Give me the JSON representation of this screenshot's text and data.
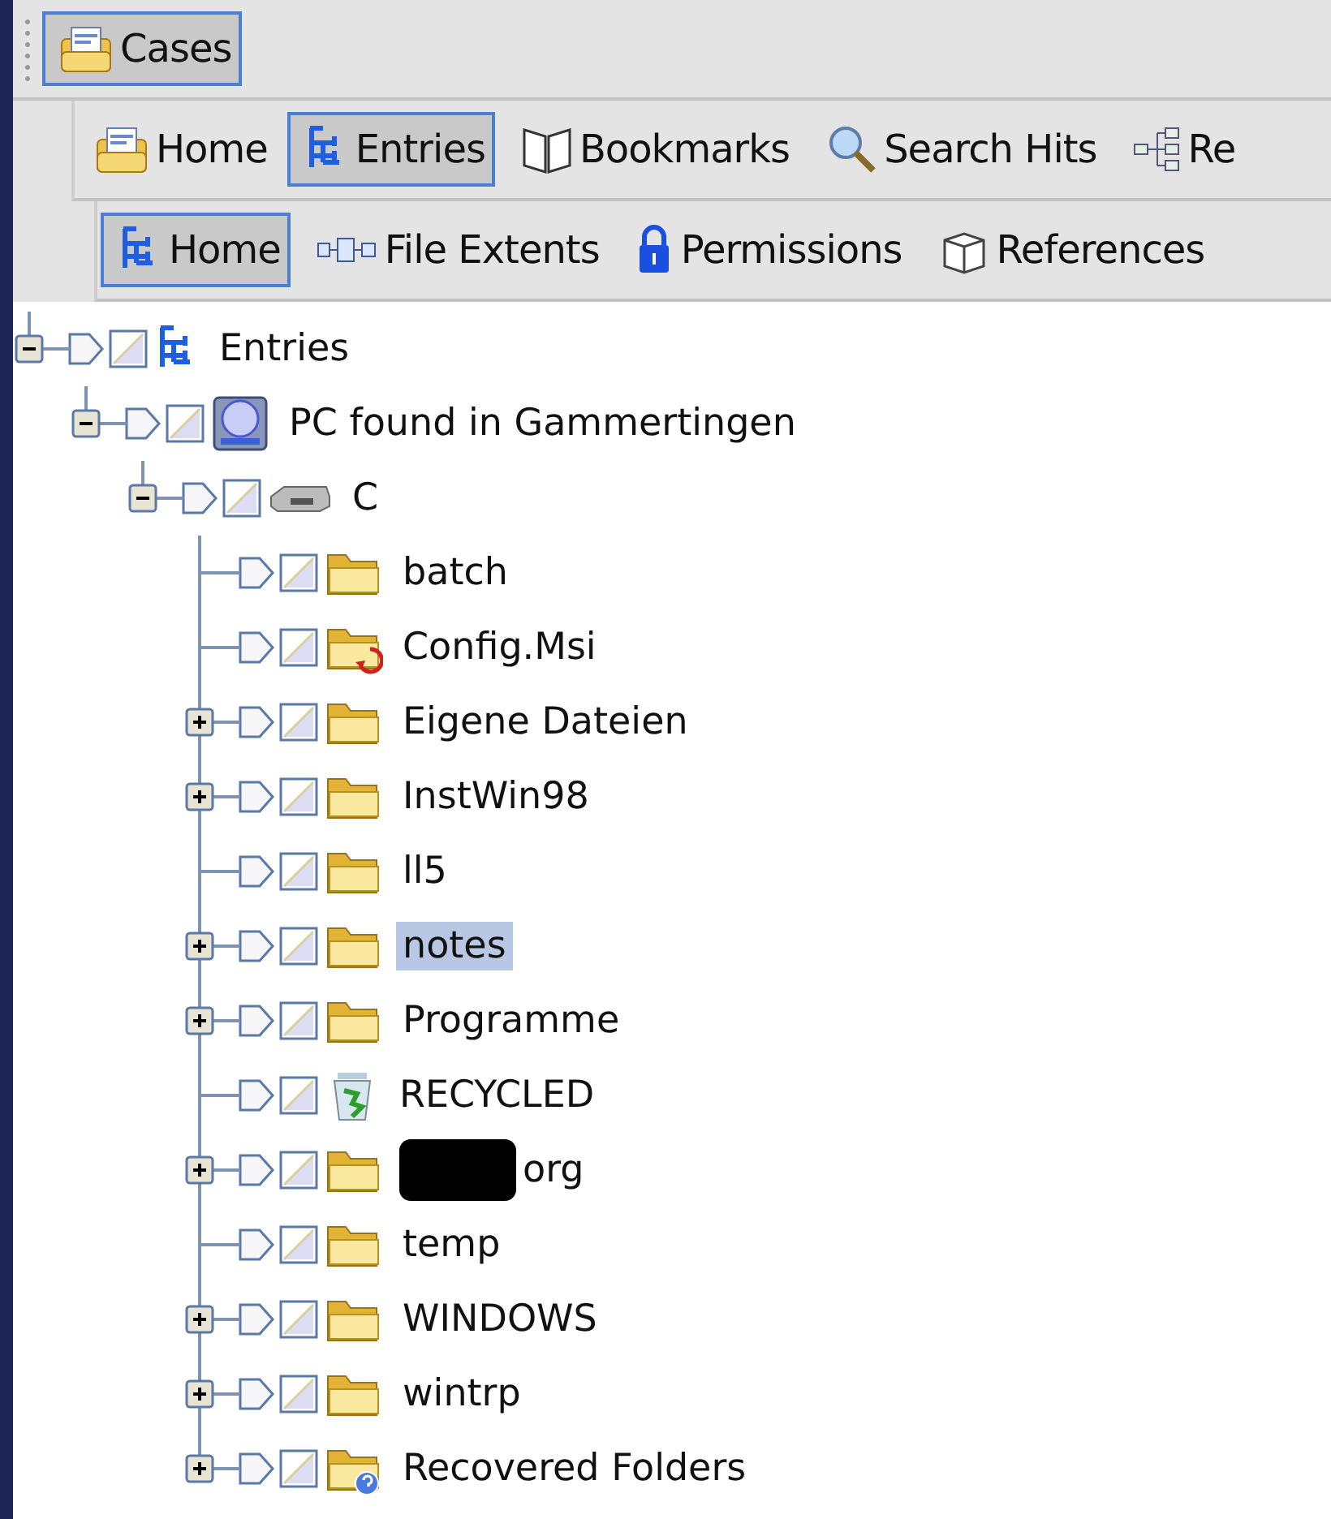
{
  "toolbars": [
    {
      "grip": true,
      "buttons": [
        {
          "label": "Cases",
          "kind": "case",
          "selected": true
        }
      ]
    },
    {
      "grip": false,
      "buttons": [
        {
          "label": "Home",
          "kind": "case",
          "selected": false
        },
        {
          "label": "Entries",
          "kind": "tree",
          "selected": true
        },
        {
          "label": "Bookmarks",
          "kind": "book",
          "selected": false
        },
        {
          "label": "Search Hits",
          "kind": "search",
          "selected": false
        },
        {
          "label": "Re",
          "kind": "nodes",
          "selected": false
        }
      ]
    },
    {
      "grip": false,
      "buttons": [
        {
          "label": "Home",
          "kind": "tree",
          "selected": true
        },
        {
          "label": "File Extents",
          "kind": "extents",
          "selected": false
        },
        {
          "label": "Permissions",
          "kind": "lock",
          "selected": false
        },
        {
          "label": "References",
          "kind": "box",
          "selected": false
        }
      ]
    }
  ],
  "tree": [
    {
      "label": "Entries",
      "kind": "tree",
      "expanded": true,
      "checked": false,
      "selected": false,
      "children": [
        {
          "label": "PC found in Gammertingen",
          "kind": "computer",
          "expanded": true,
          "checked": false,
          "selected": false,
          "children": [
            {
              "label": "C",
              "kind": "drive",
              "expanded": true,
              "checked": false,
              "selected": false,
              "children": [
                {
                  "label": "batch",
                  "kind": "folder",
                  "checked": false,
                  "selected": false
                },
                {
                  "label": "Config.Msi",
                  "kind": "folder-arrow",
                  "checked": false,
                  "selected": false
                },
                {
                  "label": "Eigene Dateien",
                  "kind": "folder",
                  "expanded": false,
                  "checked": false,
                  "selected": false
                },
                {
                  "label": "InstWin98",
                  "kind": "folder",
                  "expanded": false,
                  "checked": false,
                  "selected": false
                },
                {
                  "label": "ll5",
                  "kind": "folder",
                  "checked": false,
                  "selected": false
                },
                {
                  "label": "notes",
                  "kind": "folder",
                  "expanded": false,
                  "checked": false,
                  "selected": true
                },
                {
                  "label": "Programme",
                  "kind": "folder",
                  "expanded": false,
                  "checked": false,
                  "selected": false
                },
                {
                  "label": "RECYCLED",
                  "kind": "recycle",
                  "checked": false,
                  "selected": false
                },
                {
                  "label": "org",
                  "kind": "folder",
                  "redacted": true,
                  "expanded": false,
                  "checked": false,
                  "selected": false
                },
                {
                  "label": "temp",
                  "kind": "folder",
                  "checked": false,
                  "selected": false
                },
                {
                  "label": "WINDOWS",
                  "kind": "folder",
                  "expanded": false,
                  "checked": false,
                  "selected": false
                },
                {
                  "label": "wintrp",
                  "kind": "folder",
                  "expanded": false,
                  "checked": false,
                  "selected": false
                },
                {
                  "label": "Recovered Folders",
                  "kind": "folder-question",
                  "expanded": false,
                  "checked": false,
                  "selected": false
                }
              ]
            }
          ]
        }
      ]
    }
  ]
}
